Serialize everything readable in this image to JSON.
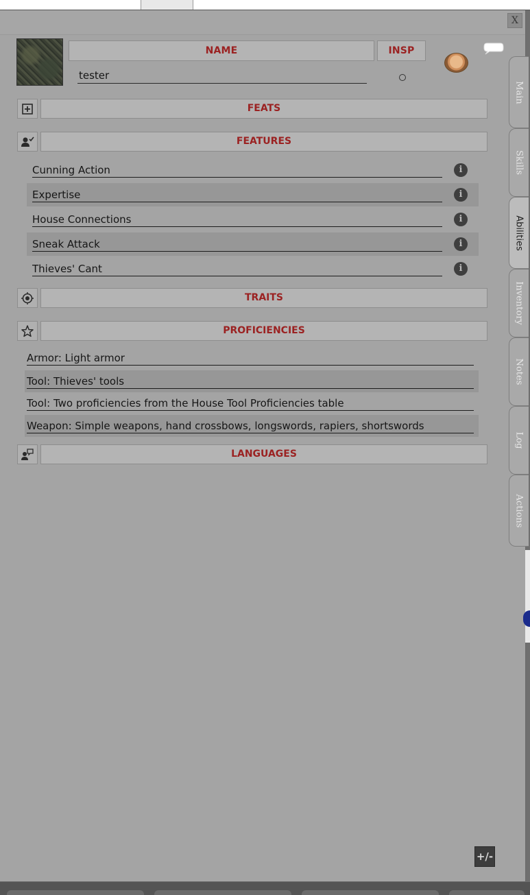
{
  "window": {
    "close_label": "X"
  },
  "header": {
    "name_label": "NAME",
    "insp_label": "INSP",
    "character_name": "tester"
  },
  "sections": {
    "feats": "FEATS",
    "features": "FEATURES",
    "traits": "TRAITS",
    "proficiencies": "PROFICIENCIES",
    "languages": "LANGUAGES"
  },
  "features": [
    "Cunning Action",
    "Expertise",
    "House Connections",
    "Sneak Attack",
    "Thieves' Cant"
  ],
  "feature_info_glyph": "i",
  "proficiencies": [
    "Armor: Light armor",
    "Tool: Thieves' tools",
    "Tool: Two proficiencies from the House Tool Proficiencies table",
    "Weapon: Simple weapons, hand crossbows, longswords, rapiers, shortswords"
  ],
  "side_tabs": [
    {
      "label": "Main",
      "active": false
    },
    {
      "label": "Skills",
      "active": false
    },
    {
      "label": "Abilities",
      "active": true
    },
    {
      "label": "Inventory",
      "active": false
    },
    {
      "label": "Notes",
      "active": false
    },
    {
      "label": "Log",
      "active": false
    },
    {
      "label": "Actions",
      "active": false
    }
  ],
  "icons": {
    "feats": "plus-box-icon",
    "features": "person-check-icon",
    "traits": "target-icon",
    "proficiencies": "star-icon",
    "languages": "speech-person-icon",
    "resize": "resize-icon",
    "chat": "speech-bubble-icon"
  },
  "resize_glyph": "+/-",
  "colors": {
    "header_text": "#9b2222",
    "panel_bg": "#a4a4a4"
  }
}
